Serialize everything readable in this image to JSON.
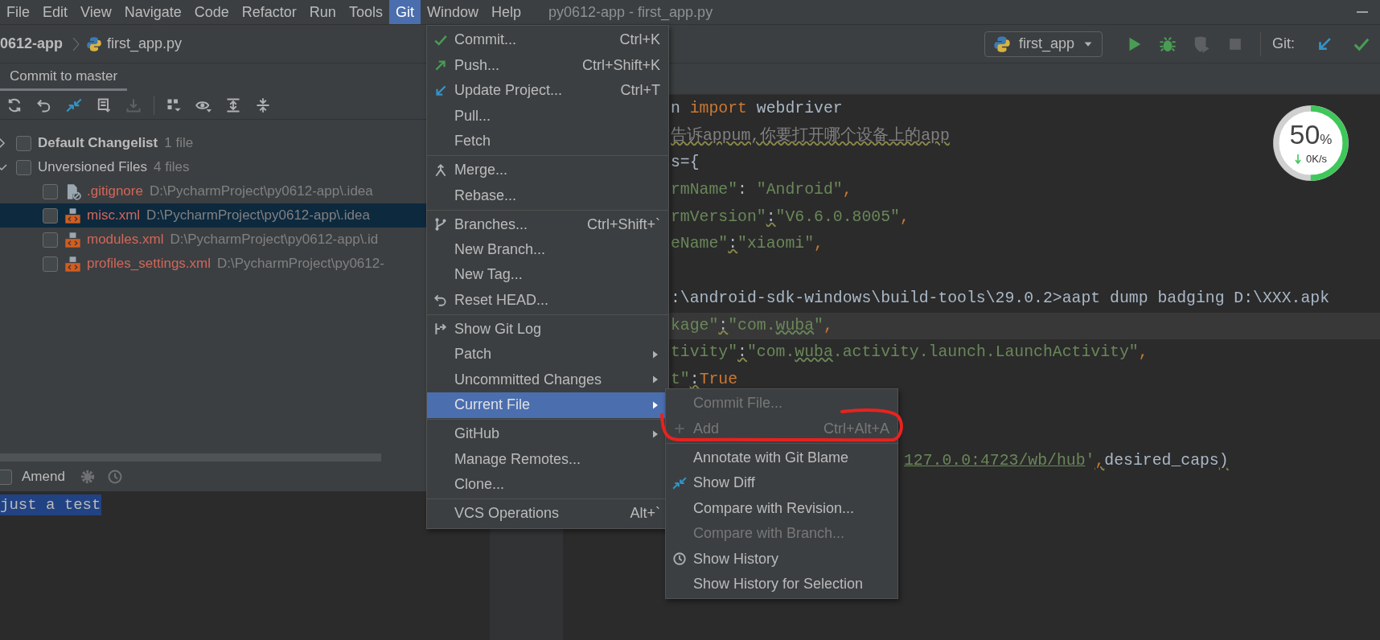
{
  "window": {
    "title": "py0612-app - first_app.py"
  },
  "menu_bar": [
    {
      "label": "File",
      "selected": false
    },
    {
      "label": "Edit",
      "selected": false
    },
    {
      "label": "View",
      "selected": false
    },
    {
      "label": "Navigate",
      "selected": false
    },
    {
      "label": "Code",
      "selected": false
    },
    {
      "label": "Refactor",
      "selected": false
    },
    {
      "label": "Run",
      "selected": false
    },
    {
      "label": "Tools",
      "selected": false
    },
    {
      "label": "Git",
      "selected": true
    },
    {
      "label": "Window",
      "selected": false
    },
    {
      "label": "Help",
      "selected": false
    }
  ],
  "navigation_bar": {
    "breadcrumbs": [
      {
        "label": "0612-app",
        "kind": "project"
      },
      {
        "label": "first_app.py",
        "kind": "python-file"
      }
    ],
    "run_configuration": "first_app",
    "toolbar": [
      {
        "kind": "run",
        "disabled": false
      },
      {
        "kind": "debug",
        "disabled": false
      },
      {
        "kind": "coverage",
        "disabled": true
      },
      {
        "kind": "stop",
        "disabled": true
      }
    ],
    "git_label": "Git:",
    "git_actions": [
      {
        "kind": "update"
      },
      {
        "kind": "commit"
      }
    ]
  },
  "commit_panel": {
    "tab": {
      "label": "Commit to master",
      "selected": true
    },
    "toolbar": [
      {
        "kind": "refresh",
        "disabled": false
      },
      {
        "kind": "rollback",
        "disabled": false
      },
      {
        "kind": "diff",
        "disabled": false
      },
      {
        "kind": "message-history",
        "disabled": false
      },
      {
        "kind": "download",
        "disabled": true
      },
      {
        "kind": "group-by",
        "disabled": false
      },
      {
        "kind": "view-options",
        "disabled": false
      },
      {
        "kind": "expand-all",
        "disabled": false
      },
      {
        "kind": "collapse-all",
        "disabled": false
      }
    ],
    "changelists": [
      {
        "label": "Default Changelist",
        "count": "1 file",
        "kind": "default",
        "expanded": false,
        "checked": false
      },
      {
        "label": "Unversioned Files",
        "count": "4 files",
        "kind": "unversioned",
        "expanded": true,
        "checked": false,
        "children": [
          {
            "name": ".gitignore",
            "path": "D:\\PycharmProject\\py0612-app\\.idea",
            "kind": "ignored",
            "checked": false,
            "selected": false
          },
          {
            "name": "misc.xml",
            "path": "D:\\PycharmProject\\py0612-app\\.idea",
            "kind": "xml",
            "checked": false,
            "selected": true
          },
          {
            "name": "modules.xml",
            "path": "D:\\PycharmProject\\py0612-app\\.id",
            "kind": "xml",
            "checked": false,
            "selected": false
          },
          {
            "name": "profiles_settings.xml",
            "path": "D:\\PycharmProject\\py0612-",
            "kind": "xml",
            "checked": false,
            "selected": false
          }
        ]
      }
    ],
    "amend": {
      "label": "Amend",
      "checked": false
    },
    "commit_message": {
      "value": "just a test",
      "selected": true
    }
  },
  "editor": {
    "lines": [
      {
        "kind": "code",
        "current": false,
        "tokens": [
          {
            "text": "n ",
            "kind": "plain"
          },
          {
            "text": "import",
            "kind": "keyword"
          },
          {
            "text": " webdriver",
            "kind": "plain"
          }
        ]
      },
      {
        "kind": "code",
        "current": false,
        "tokens": [
          {
            "text": "告诉appum,你要打开哪个设备上的app",
            "kind": "comment"
          }
        ]
      },
      {
        "kind": "code",
        "current": false,
        "tokens": [
          {
            "text": "s={",
            "kind": "plain"
          }
        ]
      },
      {
        "kind": "code",
        "current": false,
        "tokens": [
          {
            "text": "rmName\"",
            "kind": "string"
          },
          {
            "text": ": ",
            "kind": "plain"
          },
          {
            "text": "\"Android\"",
            "kind": "string"
          },
          {
            "text": ",",
            "kind": "punct"
          }
        ]
      },
      {
        "kind": "code",
        "current": false,
        "tokens": [
          {
            "text": "rmVersion\"",
            "kind": "string"
          },
          {
            "text": ":",
            "kind": "warn"
          },
          {
            "text": "\"V6.6.0.8005\"",
            "kind": "string"
          },
          {
            "text": ",",
            "kind": "punct"
          }
        ]
      },
      {
        "kind": "code",
        "current": false,
        "tokens": [
          {
            "text": "eName\"",
            "kind": "string"
          },
          {
            "text": ":",
            "kind": "warn"
          },
          {
            "text": "\"xiaomi\"",
            "kind": "string"
          },
          {
            "text": ",",
            "kind": "punct"
          }
        ]
      },
      {
        "kind": "blank",
        "current": false
      },
      {
        "kind": "code",
        "current": false,
        "tokens": [
          {
            "text": ":\\android-sdk-windows\\build-tools\\29.0.2>aapt dump badging D:\\XXX.apk",
            "kind": "plain"
          }
        ]
      },
      {
        "kind": "code",
        "current": true,
        "tokens": [
          {
            "text": "kage\"",
            "kind": "string"
          },
          {
            "text": ":",
            "kind": "warn"
          },
          {
            "text": "\"com.",
            "kind": "string"
          },
          {
            "text": "wuba",
            "kind": "string-typo"
          },
          {
            "text": "\"",
            "kind": "string"
          },
          {
            "text": ",",
            "kind": "punct"
          }
        ]
      },
      {
        "kind": "code",
        "current": false,
        "tokens": [
          {
            "text": "tivity\"",
            "kind": "string"
          },
          {
            "text": ":",
            "kind": "warn"
          },
          {
            "text": "\"com.",
            "kind": "string"
          },
          {
            "text": "wuba",
            "kind": "string-typo"
          },
          {
            "text": ".activity.launch.LaunchActivity\"",
            "kind": "string"
          },
          {
            "text": ",",
            "kind": "punct"
          }
        ]
      },
      {
        "kind": "code",
        "current": false,
        "tokens": [
          {
            "text": "t\"",
            "kind": "string"
          },
          {
            "text": ":",
            "kind": "warn"
          },
          {
            "text": "True",
            "kind": "keyword"
          }
        ]
      },
      {
        "kind": "blank",
        "current": false
      },
      {
        "kind": "blank",
        "current": false
      },
      {
        "kind": "covered-start",
        "current": false,
        "tokens": [
          {
            "text": "127.0.0:4723/wb/hub",
            "kind": "link"
          },
          {
            "text": "'",
            "kind": "string"
          },
          {
            "text": ",",
            "kind": "punct-warn"
          },
          {
            "text": "desired_caps",
            "kind": "plain"
          },
          {
            "text": ")",
            "kind": "plain-warn"
          }
        ]
      }
    ]
  },
  "speed_widget": {
    "percent": "50",
    "unit": "%",
    "rate": "0K/s",
    "level": 0.5
  },
  "git_menu": {
    "groups": [
      [
        {
          "label": "Commit...",
          "kind": "commit",
          "shortcut": "Ctrl+K",
          "submenu": false,
          "selected": false,
          "disabled": false
        },
        {
          "label": "Push...",
          "kind": "push",
          "shortcut": "Ctrl+Shift+K",
          "submenu": false,
          "selected": false,
          "disabled": false
        },
        {
          "label": "Update Project...",
          "kind": "update",
          "shortcut": "Ctrl+T",
          "submenu": false,
          "selected": false,
          "disabled": false
        },
        {
          "label": "Pull...",
          "kind": "plain",
          "submenu": false,
          "selected": false,
          "disabled": false
        },
        {
          "label": "Fetch",
          "kind": "plain",
          "submenu": false,
          "selected": false,
          "disabled": false
        }
      ],
      [
        {
          "label": "Merge...",
          "kind": "merge",
          "submenu": false,
          "selected": false,
          "disabled": false
        },
        {
          "label": "Rebase...",
          "kind": "plain",
          "submenu": false,
          "selected": false,
          "disabled": false
        }
      ],
      [
        {
          "label": "Branches...",
          "kind": "branches",
          "shortcut": "Ctrl+Shift+`",
          "submenu": false,
          "selected": false,
          "disabled": false
        },
        {
          "label": "New Branch...",
          "kind": "plain",
          "submenu": false,
          "selected": false,
          "disabled": false
        },
        {
          "label": "New Tag...",
          "kind": "plain",
          "submenu": false,
          "selected": false,
          "disabled": false
        },
        {
          "label": "Reset HEAD...",
          "kind": "reset",
          "submenu": false,
          "selected": false,
          "disabled": false
        }
      ],
      [
        {
          "label": "Show Git Log",
          "kind": "log",
          "submenu": false,
          "selected": false,
          "disabled": false
        },
        {
          "label": "Patch",
          "kind": "plain",
          "submenu": true,
          "selected": false,
          "disabled": false
        },
        {
          "label": "Uncommitted Changes",
          "kind": "plain",
          "submenu": true,
          "selected": false,
          "disabled": false
        },
        {
          "label": "Current File",
          "kind": "plain",
          "submenu": true,
          "selected": true,
          "disabled": false
        }
      ],
      [
        {
          "label": "GitHub",
          "kind": "plain",
          "submenu": true,
          "selected": false,
          "disabled": false
        },
        {
          "label": "Manage Remotes...",
          "kind": "plain",
          "submenu": false,
          "selected": false,
          "disabled": false
        },
        {
          "label": "Clone...",
          "kind": "plain",
          "submenu": false,
          "selected": false,
          "disabled": false
        }
      ],
      [
        {
          "label": "VCS Operations",
          "kind": "plain",
          "shortcut": "Alt+`",
          "submenu": false,
          "selected": false,
          "disabled": false
        }
      ]
    ]
  },
  "current_file_submenu": {
    "groups": [
      [
        {
          "label": "Commit File...",
          "kind": "plain",
          "submenu": false,
          "selected": false,
          "disabled": true
        },
        {
          "label": "Add",
          "kind": "add",
          "shortcut": "Ctrl+Alt+A",
          "submenu": false,
          "selected": false,
          "disabled": true
        }
      ],
      [
        {
          "label": "Annotate with Git Blame",
          "kind": "plain",
          "submenu": false,
          "selected": false,
          "disabled": false
        },
        {
          "label": "Show Diff",
          "kind": "diff",
          "submenu": false,
          "selected": false,
          "disabled": false
        },
        {
          "label": "Compare with Revision...",
          "kind": "plain",
          "submenu": false,
          "selected": false,
          "disabled": false
        },
        {
          "label": "Compare with Branch...",
          "kind": "plain",
          "submenu": false,
          "selected": false,
          "disabled": true
        },
        {
          "label": "Show History",
          "kind": "history",
          "submenu": false,
          "selected": false,
          "disabled": false
        },
        {
          "label": "Show History for Selection",
          "kind": "plain",
          "submenu": false,
          "selected": false,
          "disabled": false
        }
      ]
    ]
  }
}
